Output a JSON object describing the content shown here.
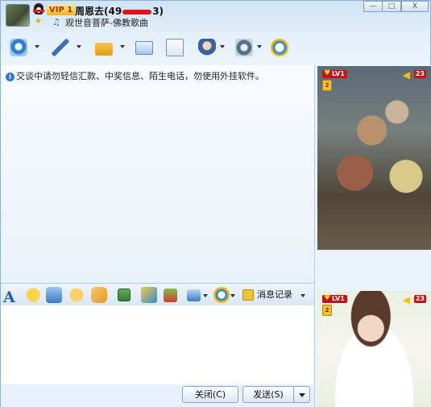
{
  "header": {
    "contact_name_start": "周恩去(49",
    "contact_name_end": "3)",
    "vip_label": "VIP 1",
    "signature": "观世音菩萨-佛教歌曲"
  },
  "window_controls": {
    "minimize": "—",
    "maximize": "□",
    "close": "X"
  },
  "toolbar": {
    "items": [
      {
        "name": "webcam-icon",
        "color": "#2f7fd3"
      },
      {
        "name": "microphone-icon",
        "color": "#3d6fb6"
      },
      {
        "name": "folder-send-icon",
        "color": "#e8a617"
      },
      {
        "name": "email-icon",
        "color": "#5b8fc9"
      },
      {
        "name": "note-add-icon",
        "color": "#2e9a4a"
      },
      {
        "name": "officer-icon",
        "color": "#3a5fa0"
      },
      {
        "name": "settings-icon",
        "color": "#5a6f8a"
      },
      {
        "name": "app-s-icon",
        "color": "#2f8fd0"
      }
    ]
  },
  "chat": {
    "info_icon": "i",
    "warning": "交谈中请勿轻信汇款、中奖信息、陌生电话，勿使用外挂软件。"
  },
  "input_toolbar": {
    "font_label": "A",
    "tools": [
      {
        "name": "emoji-icon",
        "color": "#f2b20c"
      },
      {
        "name": "magic-emoji-icon",
        "color": "#6ea4d8"
      },
      {
        "name": "shake-icon",
        "color": "#f0a82c"
      },
      {
        "name": "hand-icon",
        "color": "#f0b84a"
      },
      {
        "name": "image-icon",
        "color": "#4d8a3a"
      },
      {
        "name": "music-icon",
        "color": "#e6a41a"
      },
      {
        "name": "gift-icon",
        "color": "#d63c2b"
      },
      {
        "name": "screenshot-icon",
        "color": "#3a7bc0"
      },
      {
        "name": "app-s-icon",
        "color": "#2f8fd0"
      }
    ],
    "message_record_label": "消息记录"
  },
  "buttons": {
    "close_label": "关闭(C)",
    "send_label": "发送(S)"
  },
  "video": {
    "top": {
      "level_label": "LV1",
      "volume_label": "23",
      "user_level": "2"
    },
    "bottom": {
      "level_label": "LV1",
      "volume_label": "23",
      "user_level": "2"
    }
  }
}
